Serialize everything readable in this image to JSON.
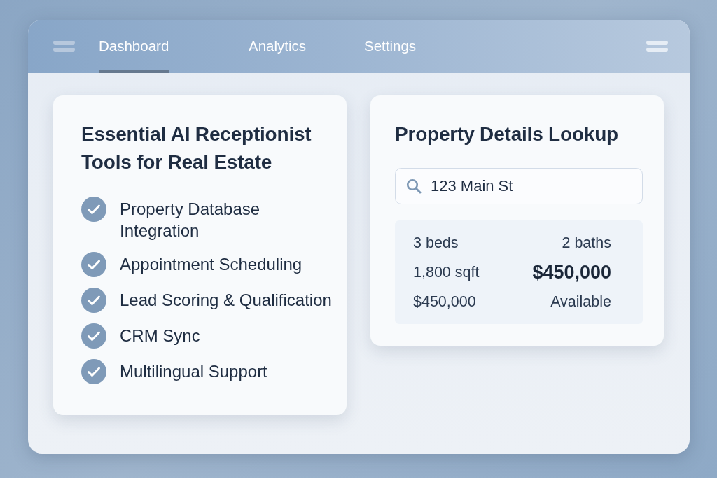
{
  "header": {
    "tabs": [
      {
        "label": "Dashboard",
        "selected": true
      },
      {
        "label": "Analytics",
        "selected": false
      },
      {
        "label": "Settings",
        "selected": false
      }
    ]
  },
  "features_card": {
    "title": "Essential AI Receptionist Tools for Real Estate",
    "items": [
      {
        "label": "Property Database Integration",
        "checked": true
      },
      {
        "label": "Appointment Scheduling",
        "checked": true
      },
      {
        "label": "Lead Scoring & Qualification",
        "checked": true
      },
      {
        "label": "CRM Sync",
        "checked": true
      },
      {
        "label": "Multilingual Support",
        "checked": true
      }
    ]
  },
  "lookup_card": {
    "title": "Property Details Lookup",
    "search": {
      "value": "123 Main St"
    },
    "details": [
      {
        "text": "3 beds",
        "emphasized": false
      },
      {
        "text": "2 baths",
        "emphasized": false
      },
      {
        "text": "1,800 sqft",
        "emphasized": false
      },
      {
        "text": "$450,000",
        "emphasized": true
      },
      {
        "text": "$450,000",
        "emphasized": false
      },
      {
        "text": "Available",
        "emphasized": false
      }
    ]
  }
}
